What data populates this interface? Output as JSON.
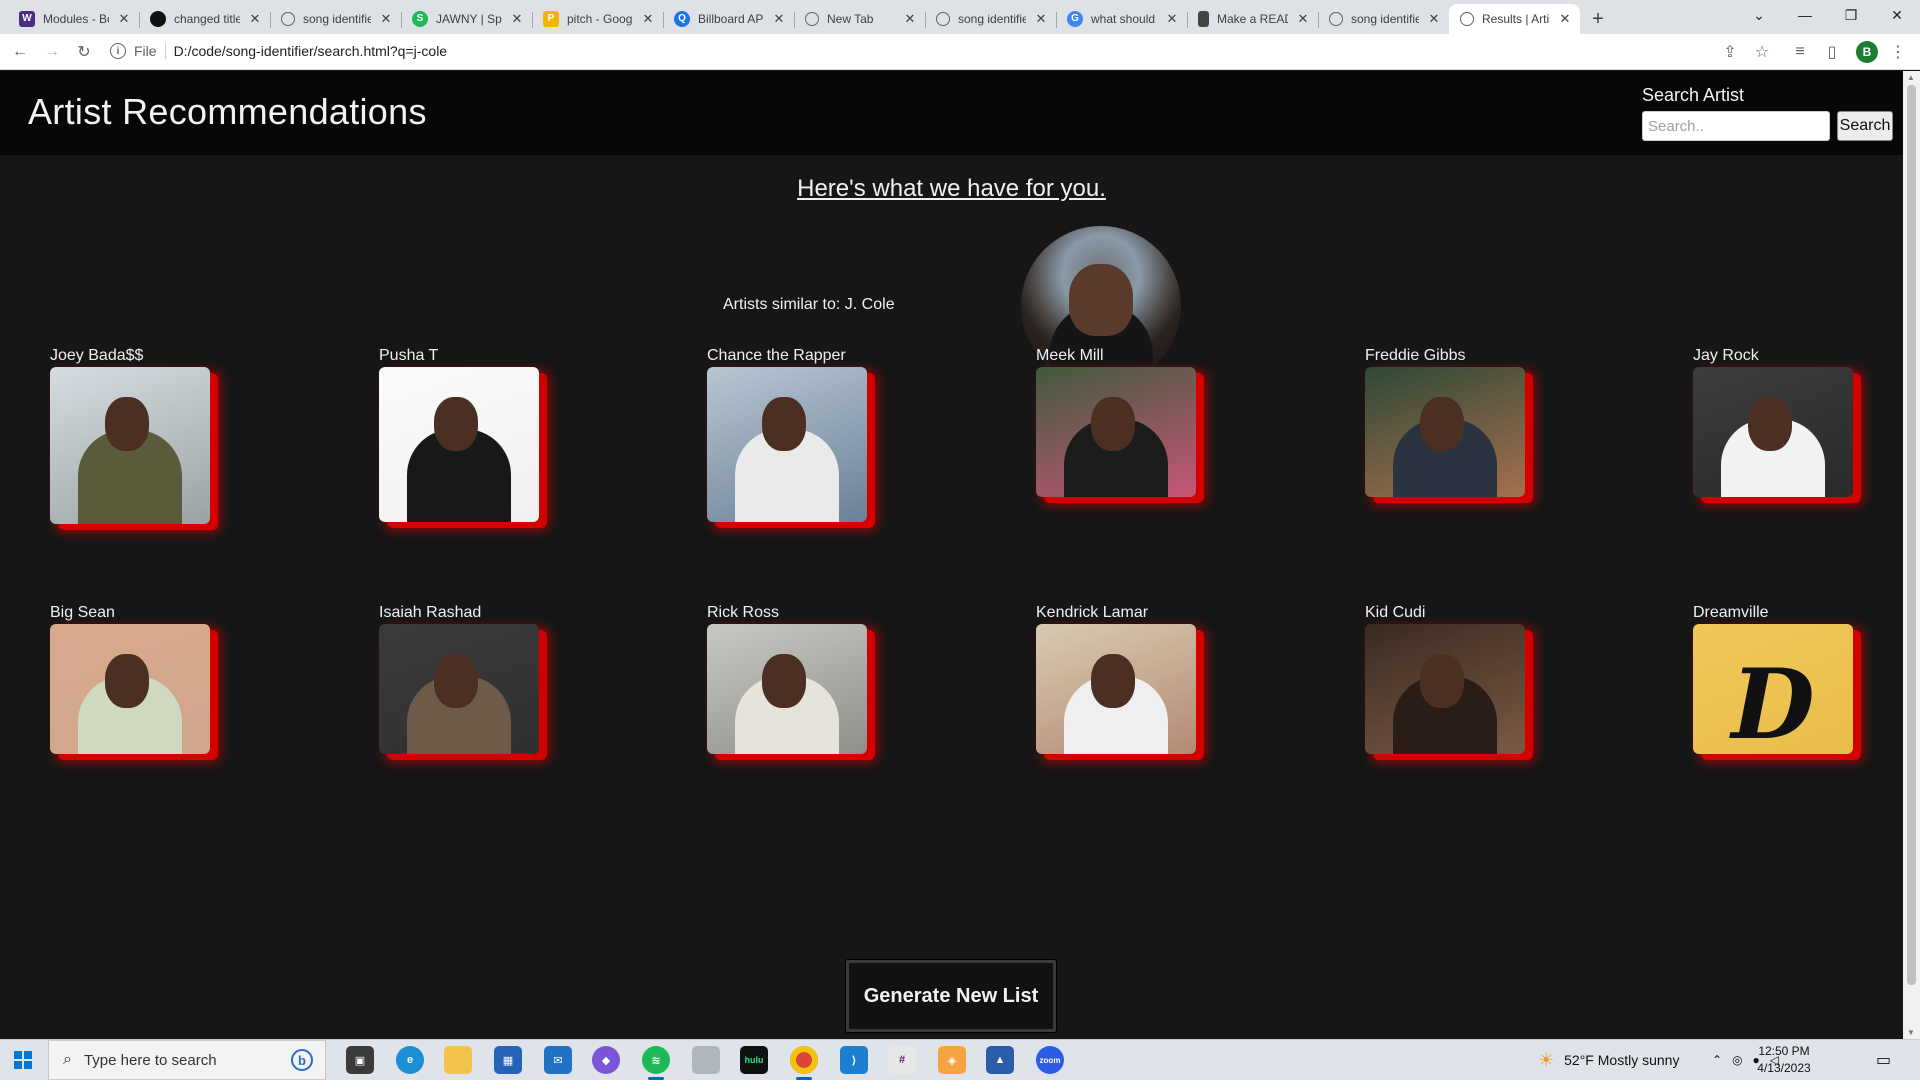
{
  "browser": {
    "tabs": [
      {
        "title": "Modules - Bo",
        "favicon": "W",
        "color": "#4b2e83"
      },
      {
        "title": "changed title",
        "favicon": "GH",
        "color": "#111111"
      },
      {
        "title": "song identifie",
        "favicon": "globe",
        "color": "#5f6368"
      },
      {
        "title": "JAWNY | Spot",
        "favicon": "S",
        "color": "#1db954"
      },
      {
        "title": "pitch - Googl",
        "favicon": "P",
        "color": "#f4b400"
      },
      {
        "title": "Billboard API",
        "favicon": "Q",
        "color": "#1a73e8"
      },
      {
        "title": "New Tab",
        "favicon": "globe",
        "color": "#5f6368"
      },
      {
        "title": "song identifie",
        "favicon": "globe",
        "color": "#5f6368"
      },
      {
        "title": "what should a",
        "favicon": "G",
        "color": "#4285f4"
      },
      {
        "title": "Make a READ",
        "favicon": "doc",
        "color": "#444444"
      },
      {
        "title": "song identifie",
        "favicon": "globe",
        "color": "#5f6368"
      },
      {
        "title": "Results | Artis",
        "favicon": "globe",
        "color": "#5f6368",
        "active": true
      }
    ],
    "address_scheme": "File",
    "address_url": "D:/code/song-identifier/search.html?q=j-cole",
    "profile_initial": "B"
  },
  "page": {
    "title": "Artist Recommendations",
    "search": {
      "label": "Search Artist",
      "placeholder": "Search..",
      "button": "Search"
    },
    "subheading": "Here's what we have for you.",
    "similar_text": "Artists similar to: J. Cole",
    "artists": [
      {
        "name": "Joey Bada$$",
        "palette": [
          "#d6dde2",
          "#9aa3a4",
          "#5b5b3c"
        ],
        "photo_height": 157
      },
      {
        "name": "Pusha T",
        "palette": [
          "#fbfbfb",
          "#f0f0f0",
          "#181818"
        ],
        "photo_height": 155
      },
      {
        "name": "Chance the Rapper",
        "palette": [
          "#b8c6d3",
          "#6c8096",
          "#eaeaea"
        ],
        "photo_height": 155
      },
      {
        "name": "Meek Mill",
        "palette": [
          "#3f5a3c",
          "#c85678",
          "#1c1c1c"
        ],
        "photo_height": 130
      },
      {
        "name": "Freddie Gibbs",
        "palette": [
          "#2f4836",
          "#a6704e",
          "#2b3240"
        ],
        "photo_height": 130
      },
      {
        "name": "Jay Rock",
        "palette": [
          "#3c3c3c",
          "#2a2a2a",
          "#f2f2f2"
        ],
        "photo_height": 130
      },
      {
        "name": "Big Sean",
        "palette": [
          "#d9a98c",
          "#cfa68d",
          "#cfd9c2"
        ],
        "photo_height": 130
      },
      {
        "name": "Isaiah Rashad",
        "palette": [
          "#3a3a3a",
          "#303030",
          "#6d5a48"
        ],
        "photo_height": 130
      },
      {
        "name": "Rick Ross",
        "palette": [
          "#c9c9c4",
          "#8f8f8a",
          "#e6e3dc"
        ],
        "photo_height": 130
      },
      {
        "name": "Kendrick Lamar",
        "palette": [
          "#d8cbb3",
          "#b48a72",
          "#efefef"
        ],
        "photo_height": 130
      },
      {
        "name": "Kid Cudi",
        "palette": [
          "#3a2a22",
          "#7a5a44",
          "#2a1c16"
        ],
        "photo_height": 130
      },
      {
        "name": "Dreamville",
        "palette": [
          "#f0c85a",
          "#e9bd4a",
          "#111111"
        ],
        "photo_height": 130,
        "logo": "D"
      }
    ],
    "generate_button": "Generate New List"
  },
  "taskbar": {
    "search_placeholder": "Type here to search",
    "weather": "52°F  Mostly sunny",
    "time": "12:50 PM",
    "date": "4/13/2023"
  }
}
